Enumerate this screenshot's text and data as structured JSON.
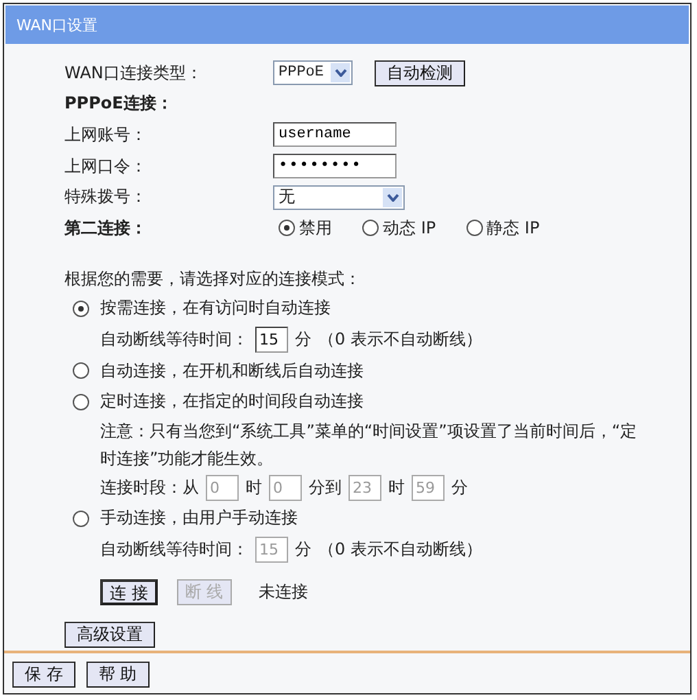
{
  "window": {
    "title": "WAN口设置"
  },
  "form": {
    "wan_type": {
      "label": "WAN口连接类型：",
      "value": "PPPoE",
      "detect_button": "自动检测"
    },
    "pppoe_heading": "PPPoE连接：",
    "account": {
      "label": "上网账号：",
      "value": "username"
    },
    "password": {
      "label": "上网口令：",
      "value": "••••••••"
    },
    "dial": {
      "label": "特殊拨号：",
      "value": "无"
    },
    "second": {
      "label": "第二连接：",
      "options": [
        {
          "label": "禁用",
          "selected": true
        },
        {
          "label": "动态 IP",
          "selected": false
        },
        {
          "label": "静态 IP",
          "selected": false
        }
      ]
    }
  },
  "mode_prompt": "根据您的需要，请选择对应的连接模式：",
  "modes": [
    {
      "label": "按需连接，在有访问时自动连接",
      "selected": true,
      "wait": {
        "label": "自动断线等待时间：",
        "value": "15",
        "unit": "分",
        "hint": "（0 表示不自动断线）",
        "disabled": false
      }
    },
    {
      "label": "自动连接，在开机和断线后自动连接",
      "selected": false
    },
    {
      "label": "定时连接，在指定的时间段自动连接",
      "selected": false,
      "note": "注意：只有当您到“系统工具”菜单的“时间设置”项设置了当前时间后，“定时连接”功能才能生效。",
      "range": {
        "label": "连接时段：从",
        "disabled": true,
        "fields": [
          {
            "value": "0",
            "unit": "时"
          },
          {
            "value": "0",
            "unit": "分到"
          },
          {
            "value": "23",
            "unit": "时"
          },
          {
            "value": "59",
            "unit": "分"
          }
        ]
      }
    },
    {
      "label": "手动连接，由用户手动连接",
      "selected": false,
      "wait": {
        "label": "自动断线等待时间：",
        "value": "15",
        "unit": "分",
        "hint": "（0 表示不自动断线）",
        "disabled": true
      }
    }
  ],
  "connect_buttons": [
    {
      "label": "连 接",
      "disabled": false
    },
    {
      "label": "断 线",
      "disabled": true
    }
  ],
  "status": "未连接",
  "advanced_button": "高级设置",
  "footer_buttons": [
    "保 存",
    "帮 助"
  ]
}
